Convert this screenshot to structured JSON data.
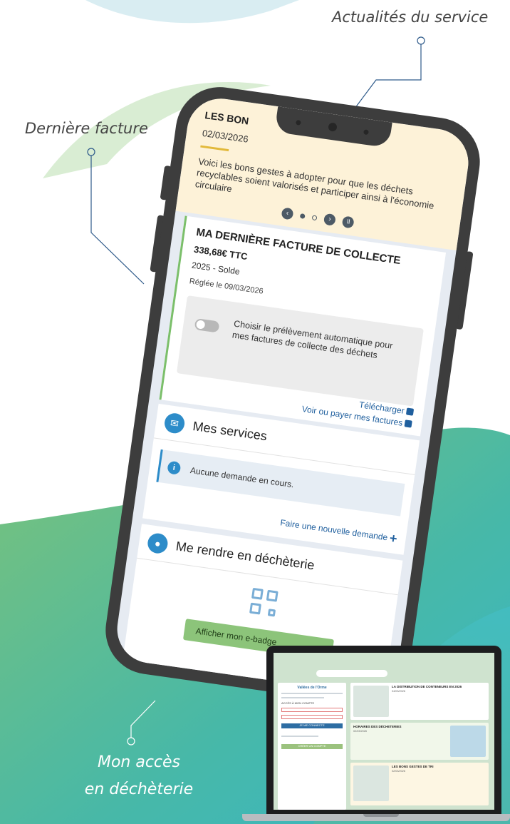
{
  "callouts": {
    "news": "Actualités du service",
    "invoice": "Dernière facture",
    "access_line1": "Mon accès",
    "access_line2": "en déchèterie"
  },
  "phone": {
    "news": {
      "title": "LES BON",
      "date": "02/03/2026",
      "text": "Voici les bons gestes à adopter pour que les déchets recyclables soient valorisés et participer ainsi à l'économie circulaire"
    },
    "carousel": {
      "prev_icon": "chevron-left-icon",
      "next_icon": "chevron-right-icon",
      "pause_icon": "pause-icon"
    },
    "invoice": {
      "title": "MA DERNIÈRE FACTURE DE COLLECTE",
      "amount": "338,68€ TTC",
      "period": "2025 - Solde",
      "paid": "Réglée le 09/03/2026",
      "auto_debit": "Choisir le prélèvement automatique pour mes factures de collecte des déchets",
      "download": "Télécharger",
      "view_pay": "Voir ou payer mes factures"
    },
    "services": {
      "title": "Mes services",
      "empty": "Aucune demande en cours.",
      "new_request": "Faire une nouvelle demande"
    },
    "dechetterie": {
      "title": "Me rendre en déchèterie",
      "badge_button": "Afficher mon e-badge"
    }
  },
  "laptop": {
    "brand": "Vallées de l'Orme",
    "login_title": "ACCÈS À MON COMPTE",
    "login_button": "JE ME CONNECTE",
    "create_button": "CRÉER UN COMPTE",
    "card1_title": "LA DISTRIBUTION DE CONTENEURS EN 2026",
    "card1_date": "04/03/2026",
    "card2_title": "HORAIRES DES DÉCHETERIES",
    "card2_date": "02/03/2026",
    "card3_title": "LES BONS GESTES DE TRI",
    "card3_date": "02/03/2026"
  },
  "colors": {
    "accent_blue": "#2d8cc9",
    "accent_green": "#8cc47a",
    "news_bg": "#fdf2d8",
    "phone_frame": "#3d3d3d"
  }
}
